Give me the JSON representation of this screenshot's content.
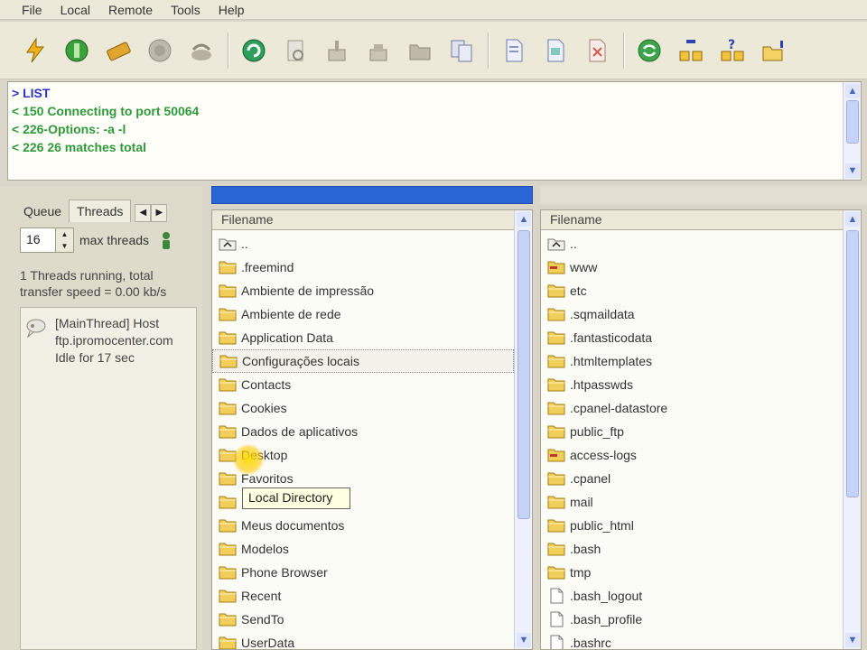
{
  "menu": [
    "File",
    "Local",
    "Remote",
    "Tools",
    "Help"
  ],
  "toolbar_icons": [
    "connect-icon",
    "quick-connect-icon",
    "site-manager-icon",
    "disconnect-icon",
    "reconnect-icon",
    "refresh-icon",
    "find-icon",
    "upload-icon",
    "download-icon",
    "new-folder-icon",
    "compare-icon",
    "view-file-icon",
    "edit-file-icon",
    "delete-file-icon",
    "sync-icon",
    "transfer-queue-icon",
    "help-icon",
    "bookmark-icon"
  ],
  "log": {
    "lines": [
      "> LIST",
      "< 150 Connecting to port 50064",
      "< 226-Options: -a -l",
      "< 226 26 matches total"
    ]
  },
  "left_panel": {
    "tabs": [
      "Queue",
      "Threads"
    ],
    "threads_value": "16",
    "max_threads_label": "max threads",
    "status_line1": "1 Threads running, total",
    "status_line2": "transfer speed = 0.00 kb/s",
    "thread_item": {
      "line1": "[MainThread] Host",
      "line2": "ftp.ipromocenter.com",
      "line3": "Idle for 17 sec"
    }
  },
  "local_pane": {
    "header": "Filename",
    "items": [
      {
        "name": "..",
        "type": "up"
      },
      {
        "name": ".freemind",
        "type": "folder"
      },
      {
        "name": "Ambiente de impressão",
        "type": "folder"
      },
      {
        "name": "Ambiente de rede",
        "type": "folder"
      },
      {
        "name": "Application Data",
        "type": "folder"
      },
      {
        "name": "Configurações locais",
        "type": "folder"
      },
      {
        "name": "Contacts",
        "type": "folder"
      },
      {
        "name": "Cookies",
        "type": "folder"
      },
      {
        "name": "Dados de aplicativos",
        "type": "folder"
      },
      {
        "name": "Desktop",
        "type": "folder"
      },
      {
        "name": "Favoritos",
        "type": "folder"
      },
      {
        "name": "",
        "type": "folder"
      },
      {
        "name": "Meus documentos",
        "type": "folder"
      },
      {
        "name": "Modelos",
        "type": "folder"
      },
      {
        "name": "Phone Browser",
        "type": "folder"
      },
      {
        "name": "Recent",
        "type": "folder"
      },
      {
        "name": "SendTo",
        "type": "folder"
      },
      {
        "name": "UserData",
        "type": "folder"
      }
    ],
    "tooltip": "Local Directory"
  },
  "remote_pane": {
    "header": "Filename",
    "items": [
      {
        "name": "..",
        "type": "up"
      },
      {
        "name": "www",
        "type": "link-folder"
      },
      {
        "name": "etc",
        "type": "folder"
      },
      {
        "name": ".sqmaildata",
        "type": "folder"
      },
      {
        "name": ".fantasticodata",
        "type": "folder"
      },
      {
        "name": ".htmltemplates",
        "type": "folder"
      },
      {
        "name": ".htpasswds",
        "type": "folder"
      },
      {
        "name": ".cpanel-datastore",
        "type": "folder"
      },
      {
        "name": "public_ftp",
        "type": "folder"
      },
      {
        "name": "access-logs",
        "type": "link-folder"
      },
      {
        "name": ".cpanel",
        "type": "folder"
      },
      {
        "name": "mail",
        "type": "folder"
      },
      {
        "name": "public_html",
        "type": "folder"
      },
      {
        "name": ".bash",
        "type": "folder"
      },
      {
        "name": "tmp",
        "type": "folder"
      },
      {
        "name": ".bash_logout",
        "type": "file"
      },
      {
        "name": ".bash_profile",
        "type": "file"
      },
      {
        "name": ".bashrc",
        "type": "file"
      }
    ]
  },
  "colors": {
    "log_command": "#2c34c8",
    "log_response": "#2f9a3a",
    "progress": "#2b66d6",
    "folder": "#f2cf5a"
  }
}
